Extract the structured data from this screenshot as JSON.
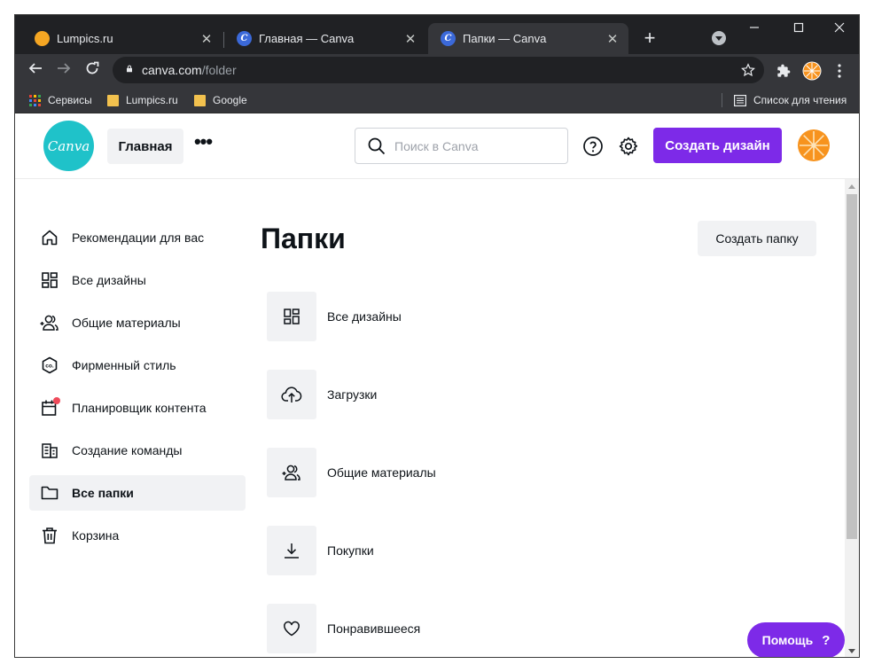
{
  "browser": {
    "tabs": [
      {
        "title": "Lumpics.ru",
        "favicon": "lumpics-favicon",
        "favicon_color": "#f5a623"
      },
      {
        "title": "Главная — Canva",
        "favicon": "canva-favicon",
        "favicon_color": "#3b69d9"
      },
      {
        "title": "Папки — Canva",
        "favicon": "canva-favicon",
        "favicon_color": "#3b69d9",
        "active": true
      }
    ],
    "new_tab_glyph": "+",
    "close_glyph": "✕",
    "url_host": "canva.com",
    "url_path": "/folder",
    "bookmarks": [
      {
        "label": "Сервисы",
        "icon": "apps-grid-icon"
      },
      {
        "label": "Lumpics.ru",
        "icon": "folder-icon"
      },
      {
        "label": "Google",
        "icon": "folder-icon"
      }
    ],
    "reading_list": "Список для чтения"
  },
  "header": {
    "logo_text": "Canva",
    "home_label": "Главная",
    "more_glyph": "•••",
    "search_placeholder": "Поиск в Canva",
    "create_label": "Создать дизайн",
    "brand_color": "#7d2ae8",
    "logo_color": "#1fc2c9"
  },
  "sidebar": {
    "items": [
      {
        "label": "Рекомендации для вас",
        "icon": "home-icon"
      },
      {
        "label": "Все дизайны",
        "icon": "grid-icon"
      },
      {
        "label": "Общие материалы",
        "icon": "people-icon"
      },
      {
        "label": "Фирменный стиль",
        "icon": "brand-kit-icon"
      },
      {
        "label": "Планировщик контента",
        "icon": "calendar-icon"
      },
      {
        "label": "Создание команды",
        "icon": "building-icon"
      },
      {
        "label": "Все папки",
        "icon": "folder-icon",
        "active": true
      },
      {
        "label": "Корзина",
        "icon": "trash-icon"
      }
    ]
  },
  "main": {
    "title": "Папки",
    "new_folder_label": "Создать папку",
    "folders": [
      {
        "label": "Все дизайны",
        "icon": "grid-icon"
      },
      {
        "label": "Загрузки",
        "icon": "cloud-upload-icon"
      },
      {
        "label": "Общие материалы",
        "icon": "people-icon"
      },
      {
        "label": "Покупки",
        "icon": "download-icon"
      },
      {
        "label": "Понравившееся",
        "icon": "heart-icon"
      }
    ]
  },
  "help": {
    "label": "Помощь",
    "glyph": "?"
  }
}
